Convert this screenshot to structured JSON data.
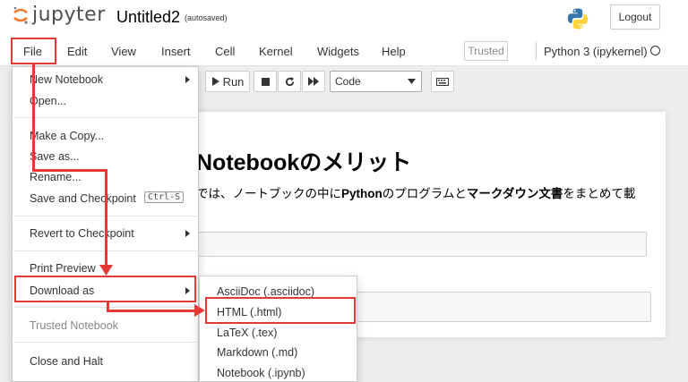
{
  "header": {
    "logo_text": "jupyter",
    "notebook_title": "Untitled2",
    "autosave_status": "(autosaved)",
    "logout_label": "Logout"
  },
  "menubar": {
    "items": [
      "File",
      "Edit",
      "View",
      "Insert",
      "Cell",
      "Kernel",
      "Widgets",
      "Help"
    ],
    "trusted_label": "Trusted",
    "kernel_name": "Python 3 (ipykernel)"
  },
  "toolbar": {
    "run_label": "Run",
    "cell_type": "Code"
  },
  "notebook": {
    "heading": "Notebookのメリット",
    "para_prefix": "では、ノートブックの中に",
    "para_python": "Python",
    "para_mid1": "のプログラムと",
    "para_markdown": "マークダウン文書",
    "para_suffix": "をまとめて載"
  },
  "file_menu": {
    "items": [
      {
        "label": "New Notebook",
        "has_submenu": true
      },
      {
        "label": "Open...",
        "has_submenu": false
      },
      {
        "label": "Make a Copy...",
        "has_submenu": false
      },
      {
        "label": "Save as...",
        "has_submenu": false
      },
      {
        "label": "Rename...",
        "has_submenu": false
      },
      {
        "label": "Save and Checkpoint",
        "has_submenu": false,
        "shortcut": "Ctrl-S"
      },
      {
        "label": "Revert to Checkpoint",
        "has_submenu": true
      },
      {
        "label": "Print Preview",
        "has_submenu": false
      },
      {
        "label": "Download as",
        "has_submenu": true
      },
      {
        "label": "Trusted Notebook",
        "has_submenu": false,
        "disabled": true
      },
      {
        "label": "Close and Halt",
        "has_submenu": false
      }
    ]
  },
  "download_submenu": {
    "items": [
      "AsciiDoc (.asciidoc)",
      "HTML (.html)",
      "LaTeX (.tex)",
      "Markdown (.md)",
      "Notebook (.ipynb)"
    ]
  },
  "colors": {
    "highlight": "#e53935",
    "jupyter_orange": "#f37726",
    "python_blue": "#3776ab",
    "python_yellow": "#ffd43b"
  }
}
